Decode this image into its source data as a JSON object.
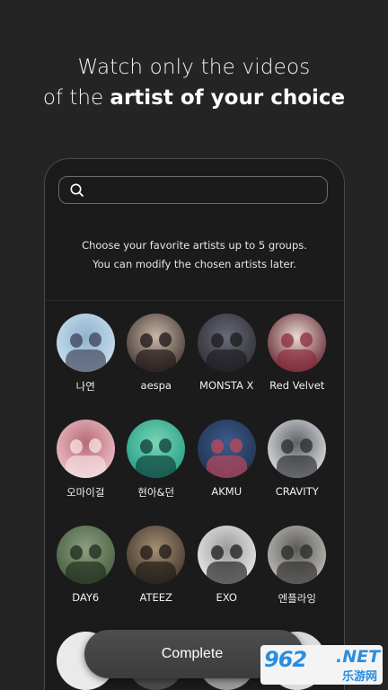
{
  "headline": {
    "line1": "Watch only the videos",
    "line2_prefix": "of the ",
    "line2_bold": "artist of your choice"
  },
  "search": {
    "placeholder": "",
    "value": "",
    "icon": "search-icon"
  },
  "intro": {
    "line1": "Choose your favorite artists up to 5 groups.",
    "line2": "You can modify the chosen artists later."
  },
  "artists": [
    {
      "name": "나연",
      "colors": [
        "#cfe3f0",
        "#8fb4cf",
        "#3b3f55"
      ]
    },
    {
      "name": "aespa",
      "colors": [
        "#3a2e2c",
        "#c9b7a6",
        "#1a1414"
      ]
    },
    {
      "name": "MONSTA X",
      "colors": [
        "#2a2a30",
        "#6a6a78",
        "#1a1a1f"
      ]
    },
    {
      "name": "Red Velvet",
      "colors": [
        "#5a1a26",
        "#e8d9d2",
        "#8b2a3a"
      ]
    },
    {
      "name": "오마이걸",
      "colors": [
        "#f3c9cf",
        "#b66b78",
        "#f8e4e6"
      ]
    },
    {
      "name": "현아&던",
      "colors": [
        "#1f9a82",
        "#7ad6b6",
        "#0d3b36"
      ]
    },
    {
      "name": "AKMU",
      "colors": [
        "#1f2f4a",
        "#3b5c8c",
        "#c4485a"
      ]
    },
    {
      "name": "CRAVITY",
      "colors": [
        "#e9ecef",
        "#5e6166",
        "#2a2b2f"
      ]
    },
    {
      "name": "DAY6",
      "colors": [
        "#3f5a3a",
        "#8d9e80",
        "#1e2a1c"
      ]
    },
    {
      "name": "ATEEZ",
      "colors": [
        "#3a3028",
        "#a58e72",
        "#1c1814"
      ]
    },
    {
      "name": "EXO",
      "colors": [
        "#f2f2f2",
        "#9a9a9a",
        "#1c1c1c"
      ]
    },
    {
      "name": "엔플라잉",
      "colors": [
        "#c9c6c0",
        "#5b5a58",
        "#2a2928"
      ]
    }
  ],
  "bottom_row_colors": [
    "#eaeaea",
    "#4a4a4a",
    "#9a9a9a",
    "#dcdcdc"
  ],
  "complete_button": {
    "label": "Complete"
  },
  "watermark": {
    "logo": "962",
    "net": ".NET",
    "sub": "乐游网"
  }
}
